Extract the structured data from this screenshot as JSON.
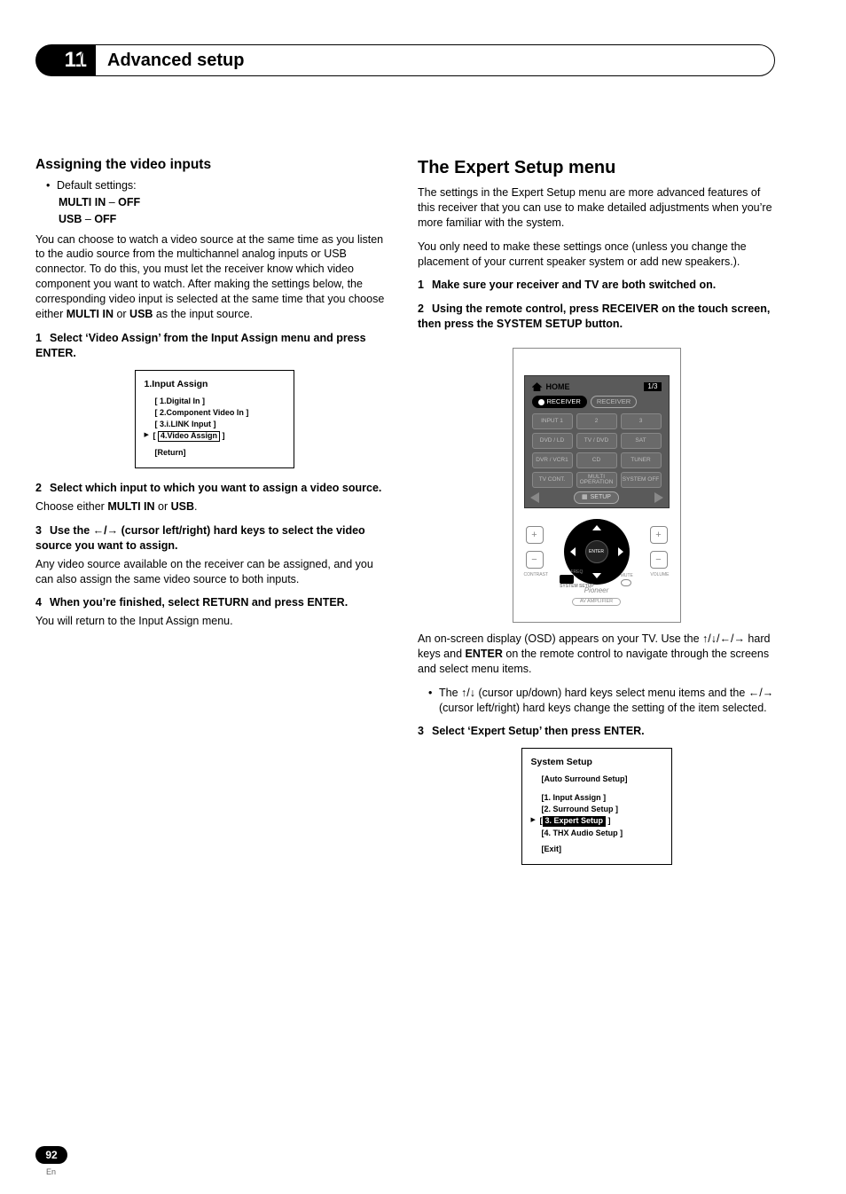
{
  "chapter": {
    "number": "11",
    "title": "Advanced setup"
  },
  "left": {
    "h2": "Assigning the video inputs",
    "bullet1": "Default settings:",
    "default1": "MULTI IN – OFF",
    "default1_a": "MULTI IN",
    "default1_b": " – ",
    "default1_c": "OFF",
    "default2_a": "USB",
    "default2_b": " – ",
    "default2_c": "OFF",
    "para1": "You can choose to watch a video source at the same time as you listen to the audio source from the multichannel analog inputs or USB connector. To do this, you must let the receiver know which video component you want to watch. After making the settings below, the corresponding video input is selected at the same time that you choose either ",
    "para1_b1": "MULTI IN",
    "para1_mid": " or ",
    "para1_b2": "USB",
    "para1_end": " as the input source.",
    "step1": "Select ‘Video Assign’ from the Input Assign menu and press ENTER.",
    "fig1": {
      "title": "1.Input Assign",
      "r1": "[ 1.Digital In ]",
      "r2": "[ 2.Component Video In ]",
      "r3": "[ 3.i.LINK Input ]",
      "r4_pre": "[ ",
      "r4_sel": "4.Video Assign",
      "r4_post": " ]",
      "ret": "[Return]"
    },
    "step2": "Select which input to which you want to assign a video source.",
    "step2_sub_a": "Choose either ",
    "step2_sub_b1": "MULTI IN",
    "step2_sub_mid": " or ",
    "step2_sub_b2": "USB",
    "step2_sub_end": ".",
    "step3_a": "Use the ",
    "step3_b": " (cursor left/right) hard keys to select the video source you want to assign.",
    "step3_sub": "Any video source available on the receiver can be assigned, and you can also assign the same video source to both inputs.",
    "step4": "When you’re finished, select RETURN and press ENTER.",
    "step4_sub": "You will return to the Input Assign menu."
  },
  "right": {
    "h1": "The Expert Setup menu",
    "para1": "The settings in the Expert Setup menu are more advanced features of this receiver that you can use to make detailed adjustments when you’re more familiar with the system.",
    "para2": "You only need to make these settings once (unless you change the placement of your current speaker system or add new speakers.).",
    "step1": "Make sure your receiver and TV are both switched on.",
    "step2": "Using the remote control, press RECEIVER on the touch screen, then press the SYSTEM SETUP button.",
    "remote": {
      "home": "HOME",
      "page": "1/3",
      "recv_active": "RECEIVER",
      "recv_ghost": "RECEIVER",
      "row1": [
        "INPUT 1",
        "2",
        "3"
      ],
      "row2": [
        "DVD / LD",
        "TV / DVD",
        "SAT"
      ],
      "row3": [
        "DVR / VCR1",
        "CD",
        "TUNER"
      ],
      "row4": [
        "TV CONT.",
        "MULTI OPERATION",
        "SYSTEM OFF"
      ],
      "setup": "SETUP",
      "brand": "Pioneer",
      "amp": "AV AMPLIFIER",
      "side_left_lbl": "CONTRAST",
      "side_right_lbl": "VOLUME",
      "under_left_a": "FREQ",
      "under_left_b": "SYSTEM SETUP",
      "under_right": "MUTE"
    },
    "para3_a": "An on-screen display (OSD) appears on your TV. Use the ",
    "para3_b": " hard keys and ",
    "para3_b1": "ENTER",
    "para3_c": " on the remote control to navigate through the screens and select menu items.",
    "bullet2_a": "The ",
    "bullet2_b": " (cursor up/down) hard keys select menu items and the ",
    "bullet2_c": " (cursor left/right) hard keys change the setting of the item selected.",
    "step3": "Select ‘Expert Setup’ then press ENTER.",
    "fig2": {
      "title": "System Setup",
      "r0": "[Auto Surround Setup]",
      "r1": "[1. Input Assign ]",
      "r2": "[2. Surround Setup ]",
      "r3_pre": "[",
      "r3_sel": "3. Expert Setup",
      "r3_post": " ]",
      "r4": "[4. THX Audio Setup ]",
      "ret": "[Exit]"
    }
  },
  "footer": {
    "page": "92",
    "lang": "En"
  },
  "glyph": {
    "left": "←",
    "right": "→",
    "up": "↑",
    "down": "↓",
    "slash": "/"
  }
}
